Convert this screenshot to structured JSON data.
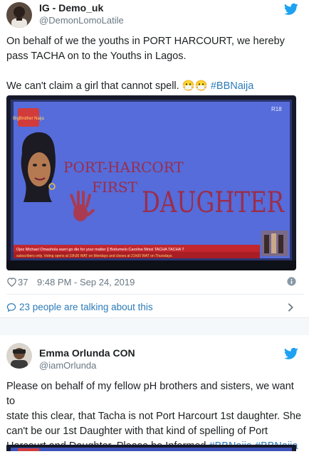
{
  "tweet1": {
    "display_name": "IG - Demo_uk",
    "handle": "@DemonLomoLatile",
    "text_line1": "On behalf of we the youths in PORT HARCOURT, we hereby",
    "text_line2": "pass TACHA on to the Youths in Lagos.",
    "text_line3": "We can't claim a girl that cannot spell.",
    "emoji": "😷😷",
    "hashtag": "#BBNaija",
    "media": {
      "board_line1": "PORT-HARCORT",
      "board_line2": "FIRST",
      "board_line3": "DAUGHTER",
      "ticker": "Ojez Michael Omashola warri go die for your matter  ∥ Boitumelo Caroline Mnisi TACHA TACHA T",
      "ticker2": "subscribers only. Voting opens at 19h30 WAT on Mondays and closes at 21h00 WAT on Thursdays.",
      "channel_logo": "BigBrother Naija",
      "age_badge": "R18"
    },
    "likes": "37",
    "timestamp": "9:48 PM - Sep 24, 2019",
    "talking": "23 people are talking about this"
  },
  "tweet2": {
    "display_name": "Emma Orlunda CON",
    "handle": "@iamOrlunda",
    "text_line1": "Please on behalf of my fellow pH brothers and sisters, we want to",
    "text_line2": "state this clear, that Tacha is not Port Harcourt 1st daughter. She",
    "text_line3": "can't be our 1st Daughter with that kind of spelling of Port",
    "text_line4": "Harcourt and Daughter. Please be Informed",
    "hashtag1": "#BBNaija",
    "hashtag2": "#BBNajia"
  },
  "colors": {
    "twitter_blue": "#1da1f2",
    "link": "#2b7bb9",
    "muted": "#697882",
    "screen_blue": "#4a63d6",
    "marker": "#9b2d4a"
  },
  "icons": [
    "twitter-bird-icon",
    "heart-icon",
    "info-icon",
    "comment-icon",
    "chevron-right-icon"
  ]
}
